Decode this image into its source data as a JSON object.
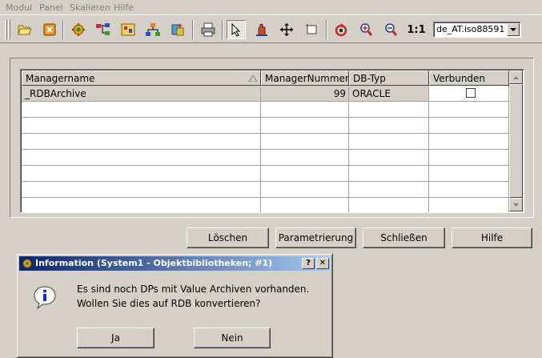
{
  "menu": [
    "Modul",
    "Panel",
    "Skalieren",
    "Hilfe"
  ],
  "toolbar": {
    "icons": [
      "open-folder-icon",
      "close-icon",
      "gear-icon",
      "tree-icon",
      "object-library-icon",
      "hierarchy-icon",
      "wizard-icon",
      "print-icon",
      "pointer-icon",
      "pan-icon",
      "move-icon",
      "crop-icon",
      "refresh-icon",
      "zoom-in-icon",
      "zoom-out-icon",
      "actual-size-icon"
    ],
    "actual_size_label": "1:1",
    "encoding_value": "de_AT.iso88591"
  },
  "table": {
    "columns": [
      "Managername",
      "ManagerNummer",
      "DB-Typ",
      "Verbunden"
    ],
    "rows": [
      {
        "managername": "_RDBArchive",
        "managernummer": "99",
        "dbtyp": "ORACLE",
        "verbunden": false
      }
    ]
  },
  "buttons": {
    "loeschen": "Löschen",
    "parametrierung": "Parametrierung",
    "schliessen": "Schließen",
    "hilfe": "Hilfe"
  },
  "dialog": {
    "title": "Information (System1 - Objektbibliotheken; #1)",
    "help_glyph": "?",
    "close_glyph": "✕",
    "message_line1": "Es sind noch DPs mit Value Archiven vorhanden.",
    "message_line2": "Wollen Sie dies auf RDB konvertieren?",
    "yes_label": "Ja",
    "no_label": "Nein"
  },
  "colors": {
    "title_gradient_start": "#0a246a",
    "title_gradient_end": "#a6caf0",
    "window_bg": "#d4d0c8"
  }
}
